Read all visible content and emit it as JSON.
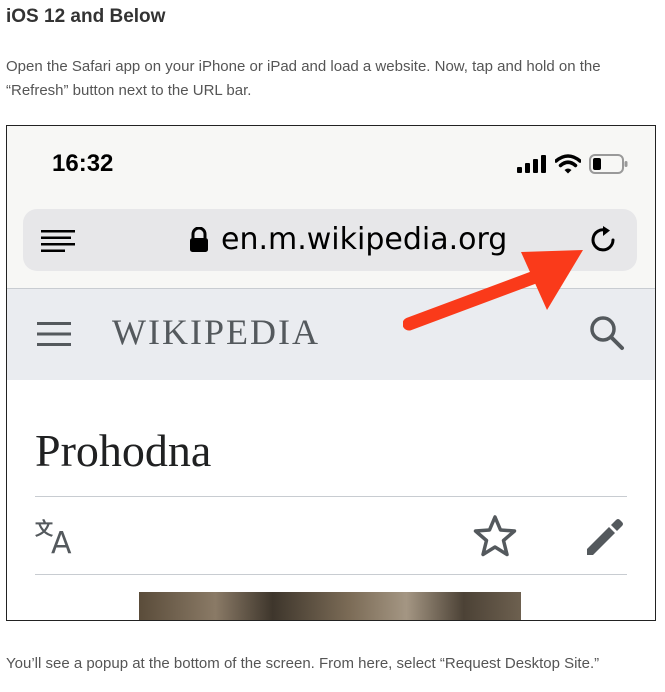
{
  "article": {
    "heading": "iOS 12 and Below",
    "paragraph1": "Open the Safari app on your iPhone or iPad and load a website. Now, tap and hold on the “Refresh” button next to the URL bar.",
    "paragraph2": "You’ll see a popup at the bottom of the screen. From here, select “Request Desktop Site.”"
  },
  "phone": {
    "status_time": "16:32",
    "url": "en.m.wikipedia.org",
    "wiki_logo": "WIKIPEDIA",
    "page_title": "Prohodna",
    "icons": [
      "cellular-signal-icon",
      "wifi-icon",
      "battery-icon",
      "reader-view-icon",
      "lock-icon",
      "refresh-icon",
      "menu-icon",
      "search-icon",
      "language-icon",
      "star-icon",
      "pencil-icon",
      "arrow-annotation"
    ],
    "colors": {
      "arrow": "#fa3a1a",
      "wiki_header_bg": "#eaecf0",
      "url_bar_bg": "#e7e7e9"
    }
  }
}
